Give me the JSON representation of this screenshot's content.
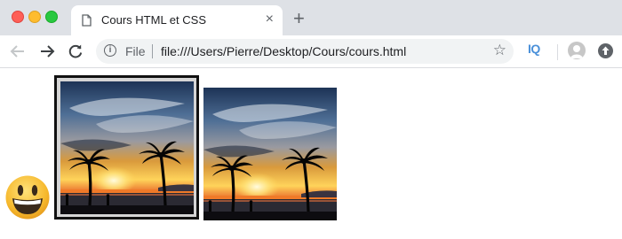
{
  "window": {
    "tab_title": "Cours HTML et CSS",
    "tab_close_glyph": "×",
    "new_tab_glyph": "+"
  },
  "toolbar": {
    "scheme_label": "File",
    "url": "file:///Users/Pierre/Desktop/Cours/cours.html",
    "bookmark_glyph": "☆",
    "extension_label": "IQ",
    "info_glyph": "i"
  },
  "content": {
    "images": [
      {
        "name": "sunset-palm-photo-bordered",
        "bordered": true
      },
      {
        "name": "sunset-palm-photo",
        "bordered": false
      }
    ],
    "emoji": "grinning-face"
  },
  "colors": {
    "chrome": "#dee1e6",
    "close": "#fe5f57",
    "minimize": "#febc2e",
    "maximize": "#28c840",
    "extension": "#4a90d9"
  }
}
